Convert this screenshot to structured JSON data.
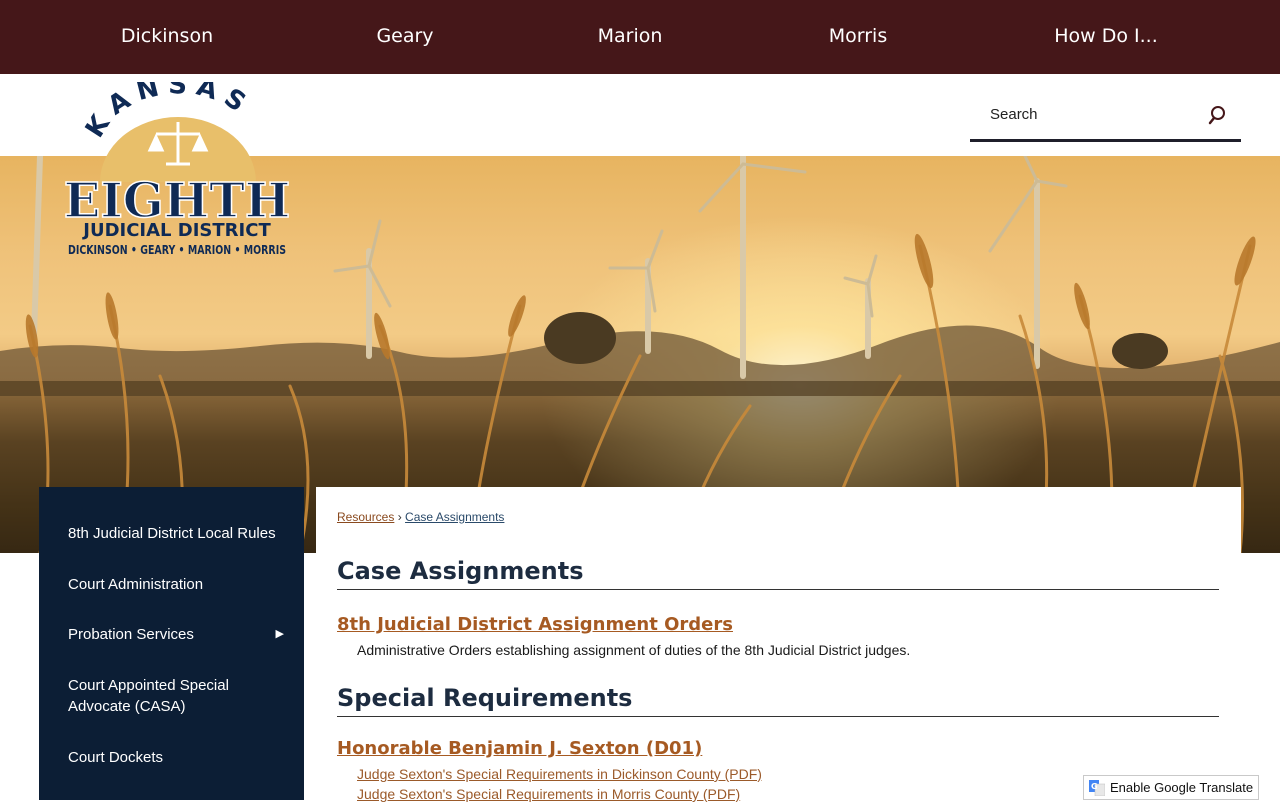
{
  "topnav": {
    "items": [
      {
        "label": "Dickinson"
      },
      {
        "label": "Geary"
      },
      {
        "label": "Marion"
      },
      {
        "label": "Morris"
      },
      {
        "label": "How Do I..."
      }
    ]
  },
  "logo": {
    "arc_text": "KANSAS",
    "main_text": "EIGHTH",
    "sub_text": "JUDICIAL DISTRICT",
    "counties_text": "DICKINSON • GEARY • MARION • MORRIS"
  },
  "search": {
    "placeholder": "Search",
    "icon": "search-icon"
  },
  "sidebar": {
    "items": [
      {
        "label": "8th Judicial District Local Rules"
      },
      {
        "label": "Court Administration"
      },
      {
        "label": "Probation Services",
        "has_submenu": true
      },
      {
        "label": "Court Appointed Special Advocate (CASA)"
      },
      {
        "label": "Court Dockets"
      }
    ]
  },
  "breadcrumb": {
    "parent": "Resources",
    "separator": "›",
    "current": "Case Assignments"
  },
  "main": {
    "sections": [
      {
        "heading": "Case Assignments",
        "link_title": "8th Judicial District Assignment Orders",
        "description": "Administrative Orders establishing assignment of duties of the 8th Judicial District judges."
      },
      {
        "heading": "Special Requirements",
        "link_title": "Honorable Benjamin J. Sexton (D01)",
        "documents": [
          "Judge Sexton's Special Requirements in Dickinson County (PDF)",
          "Judge Sexton's Special Requirements in Morris County (PDF)"
        ]
      }
    ]
  },
  "translate": {
    "label": "Enable Google Translate"
  },
  "colors": {
    "topnav_bg": "#451719",
    "sidebar_bg": "#0c1e35",
    "link_accent": "#a65a22",
    "heading": "#1d2c40"
  }
}
